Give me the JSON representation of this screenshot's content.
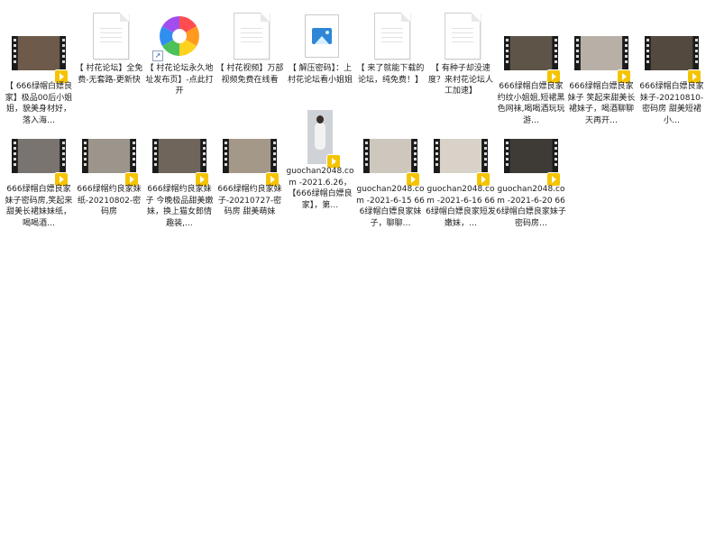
{
  "files": [
    {
      "kind": "video",
      "label": "【 666绿帽白嫖良家】极品00后小姐姐，貌美身材好，落入海…",
      "scene": "#6d5a4a"
    },
    {
      "kind": "document",
      "label": "【 村花论坛】全免费-无套路-更新快"
    },
    {
      "kind": "shortcut",
      "label": "【 村花论坛永久地址发布页】-点此打开"
    },
    {
      "kind": "document",
      "label": "【 村花视频】万部视频免费在线看"
    },
    {
      "kind": "image",
      "label": "【 解压密码】：上村花论坛看小姐姐"
    },
    {
      "kind": "document",
      "label": "【 来了就能下载的论坛，纯免费！】"
    },
    {
      "kind": "document",
      "label": "【 有种子却没速度？来村花论坛人工加速】"
    },
    {
      "kind": "video",
      "label": "666绿帽白嫖良家约纹小姐姐,短裙黑色网袜,喝喝酒玩玩游…",
      "scene": "#5e5448"
    },
    {
      "kind": "video",
      "label": "666绿帽白嫖良家妹子 笑起来甜美长裙妹子，喝酒聊聊天再开…",
      "scene": "#b8b0a6"
    },
    {
      "kind": "video",
      "label": "666绿帽白嫖良家妹子-20210810-密码房 甜美短裙小…",
      "scene": "#53493f"
    },
    {
      "kind": "video",
      "label": "666绿帽白嫖良家妹子密码房,笑起来甜美长裙妹妹纸，喝喝酒…",
      "scene": "#7a7470"
    },
    {
      "kind": "video",
      "label": "666绿帽约良家妹纸-20210802-密码房",
      "scene": "#9c958c"
    },
    {
      "kind": "video",
      "label": "666绿帽约良家妹子 今晚极品甜美嫩妹，换上猫女郎情趣装,…",
      "scene": "#6f655a"
    },
    {
      "kind": "video",
      "label": "666绿帽约良家妹子-20210727-密码房 甜美萌妹",
      "scene": "#a49988"
    },
    {
      "kind": "portrait",
      "label": "guochan2048.com -2021.6.26，【666绿帽白嫖良家】，第…"
    },
    {
      "kind": "video",
      "label": "guochan2048.com -2021-6-15 666绿帽白嫖良家妹子，聊聊…",
      "scene": "#cdc7bd"
    },
    {
      "kind": "video",
      "label": "guochan2048.com -2021-6-16 666绿帽白嫖良家短发嫩妹，…",
      "scene": "#d8d2c8"
    },
    {
      "kind": "video",
      "label": "guochan2048.com -2021-6-20 666绿帽白嫖良家妹子密码房…",
      "scene": "#3e3a36"
    }
  ],
  "colors": {
    "background": "#ffffff",
    "badge": "#f5c400",
    "text": "#222222"
  }
}
